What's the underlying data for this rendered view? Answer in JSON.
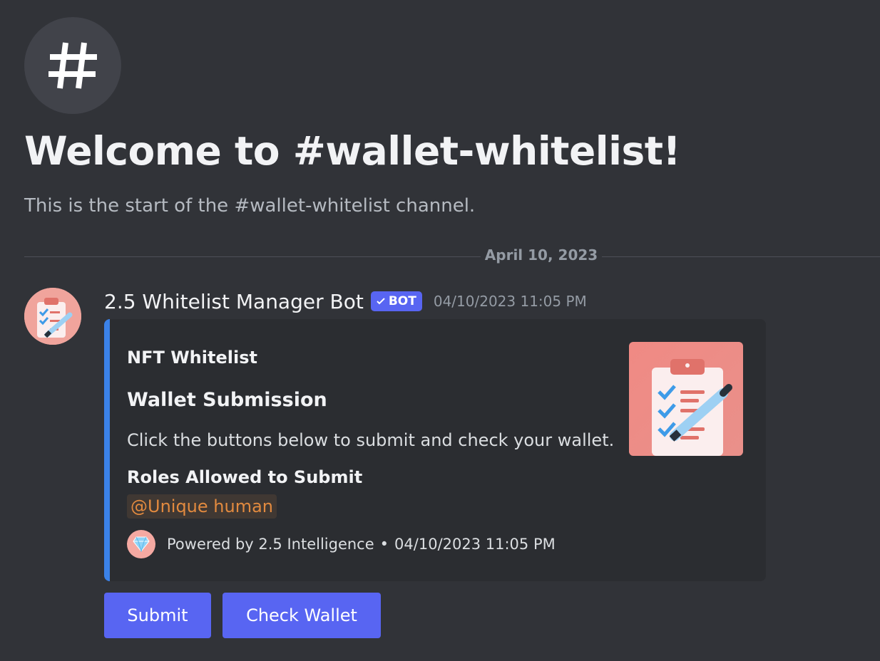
{
  "channel": {
    "icon": "hash-icon",
    "welcome_title": "Welcome to #wallet-whitelist!",
    "welcome_subtitle": "This is the start of the #wallet-whitelist channel."
  },
  "date_divider": "April 10, 2023",
  "message": {
    "author": "2.5 Whitelist Manager Bot",
    "bot_badge": "BOT",
    "timestamp": "04/10/2023 11:05 PM",
    "avatar_icon": "clipboard-checklist-icon",
    "embed": {
      "accent_color": "#3b82e8",
      "author": "NFT Whitelist",
      "title": "Wallet Submission",
      "description": "Click the buttons below to submit and check your wallet.",
      "field_name": "Roles Allowed to Submit",
      "field_value": "@Unique human",
      "footer_icon": "gem-icon",
      "footer_text": "Powered by 2.5 Intelligence",
      "footer_separator": "•",
      "footer_timestamp": "04/10/2023 11:05 PM",
      "thumbnail_icon": "clipboard-checklist-icon"
    },
    "buttons": {
      "submit": "Submit",
      "check_wallet": "Check Wallet"
    }
  },
  "colors": {
    "background": "#313338",
    "blurple": "#5865f2",
    "role_mention": "#e28a3f"
  }
}
